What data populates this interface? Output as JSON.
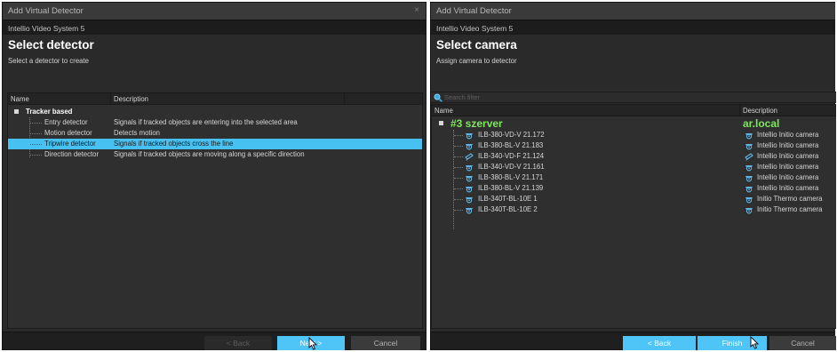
{
  "left_dialog": {
    "title": "Add Virtual Detector",
    "close_glyph": "×",
    "subtitle": "Intellio Video System 5",
    "heading": "Select detector",
    "hint": "Select a detector to create",
    "columns": {
      "name": "Name",
      "description": "Description"
    },
    "group": {
      "label": "Tracker based"
    },
    "items": [
      {
        "name": "Entry detector",
        "description": "Signals if tracked objects are entering into the selected area",
        "selected": false
      },
      {
        "name": "Motion detector",
        "description": "Detects motion",
        "selected": false
      },
      {
        "name": "Tripwire detector",
        "description": "Signals if tracked objects cross the line",
        "selected": true
      },
      {
        "name": "Direction detector",
        "description": "Signals if tracked objects are moving along a specific direction",
        "selected": false
      }
    ],
    "buttons": {
      "back": "< Back",
      "next": "Next >",
      "cancel": "Cancel"
    }
  },
  "right_dialog": {
    "title": "Add Virtual Detector",
    "subtitle": "Intellio Video System 5",
    "heading": "Select camera",
    "hint": "Assign camera to detector",
    "search": {
      "placeholder": "Search filter",
      "icon": "search-icon"
    },
    "columns": {
      "name": "Name",
      "description": "Description"
    },
    "group": {
      "label": "#3 szerver",
      "description": "ar.local"
    },
    "cameras": [
      {
        "name": "ILB-380-VD-V 21.172",
        "description": "Intellio Initio camera",
        "icon": "dome-camera-icon"
      },
      {
        "name": "ILB-380-BL-V 21.183",
        "description": "Intellio Initio camera",
        "icon": "dome-camera-icon"
      },
      {
        "name": "ILB-340-VD-F 21.124",
        "description": "Intellio Initio camera",
        "icon": "bullet-camera-icon"
      },
      {
        "name": "ILB-340-VD-V 21.161",
        "description": "Intellio Initio camera",
        "icon": "dome-camera-icon"
      },
      {
        "name": "ILB-380-BL-V 21.171",
        "description": "Intellio Initio camera",
        "icon": "dome-camera-icon"
      },
      {
        "name": "ILB-380-BL-V 21.139",
        "description": "Intellio Initio camera",
        "icon": "dome-camera-icon"
      },
      {
        "name": "ILB-340T-BL-10E 1",
        "description": "Initio Thermo camera",
        "icon": "dome-camera-icon"
      },
      {
        "name": "ILB-340T-BL-10E 2",
        "description": "Initio Thermo camera",
        "icon": "dome-camera-icon"
      }
    ],
    "buttons": {
      "back": "< Back",
      "finish": "Finish",
      "cancel": "Cancel"
    }
  },
  "colors": {
    "accent": "#4ec5f6",
    "selection": "#47c1f2",
    "group_green": "#7ee65b",
    "camera_icon": "#5fb6e6"
  }
}
